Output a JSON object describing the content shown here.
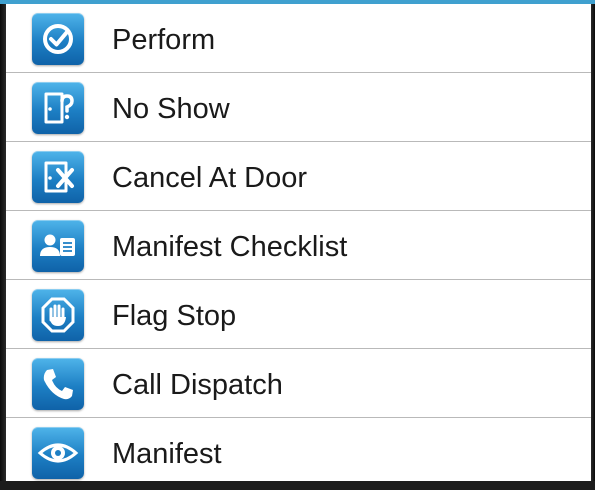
{
  "menu": {
    "items": [
      {
        "label": "Perform",
        "icon": "check-circle-icon"
      },
      {
        "label": "No Show",
        "icon": "door-question-icon"
      },
      {
        "label": "Cancel At Door",
        "icon": "door-x-icon"
      },
      {
        "label": "Manifest Checklist",
        "icon": "person-list-icon"
      },
      {
        "label": "Flag Stop",
        "icon": "stop-hand-icon"
      },
      {
        "label": "Call Dispatch",
        "icon": "phone-icon"
      },
      {
        "label": "Manifest",
        "icon": "eye-icon"
      }
    ]
  },
  "colors": {
    "accent": "#3fa0cf",
    "icon_top": "#4fb4ea",
    "icon_bottom": "#0f62a8",
    "divider": "#b9b9b9",
    "text": "#1a1a1a"
  }
}
